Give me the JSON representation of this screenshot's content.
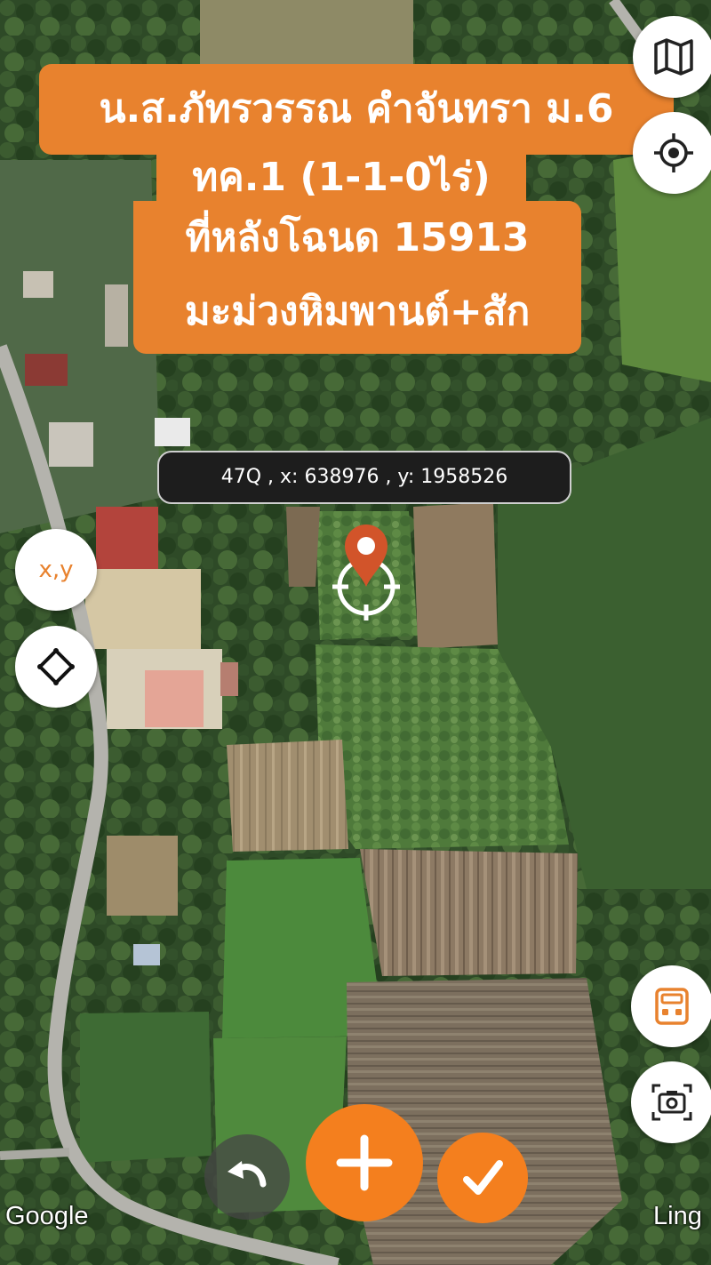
{
  "title_lines": {
    "line1": "น.ส.ภัทรวรรณ  คำจันทรา ม.6",
    "line2": "ทค.1 (1-1-0ไร่)",
    "line3": "ที่หลังโฉนด 15913",
    "line4": "มะม่วงหิมพานต์+สัก"
  },
  "coordinate_readout": "47Q , x: 638976 , y: 1958526",
  "buttons": {
    "xy_label": "x,y"
  },
  "attribution": {
    "google": "Google",
    "partial": "Ling"
  },
  "icons": {
    "map_layers": "map-icon",
    "gps": "crosshair-icon",
    "navigate": "diamond-nav-icon",
    "calculator": "calculator-icon",
    "camera": "camera-icon",
    "undo": "undo-icon",
    "add": "plus-icon",
    "confirm": "check-icon",
    "pin": "location-pin-icon"
  },
  "colors": {
    "accent": "#f47f1e",
    "title_bg": "#e8822e",
    "coord_bg": "#1d1d1d"
  }
}
